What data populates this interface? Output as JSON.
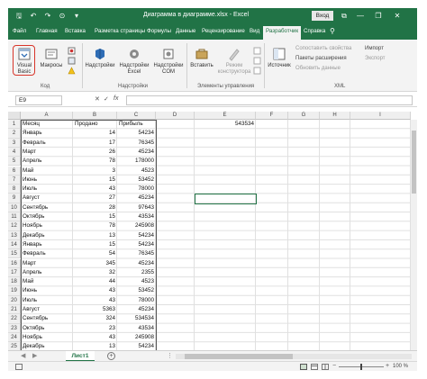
{
  "window": {
    "title": "Диаграмма в диаграмме.xlsx - Excel",
    "login_label": "Вход",
    "controls": [
      "—",
      "❐",
      "✕"
    ],
    "qat_icons": [
      "save-icon",
      "undo-icon",
      "redo-icon",
      "camera-icon",
      "customize-icon"
    ],
    "qat_glyphs": [
      "🖫",
      "↶",
      "↷",
      "⊙",
      "▾"
    ],
    "ribbon_display_glyph": "⧉"
  },
  "ribbon_tabs": [
    {
      "label": "Файл",
      "active": false
    },
    {
      "label": "Главная",
      "active": false
    },
    {
      "label": "Вставка",
      "active": false
    },
    {
      "label": "Разметка страницы",
      "active": false
    },
    {
      "label": "Формулы",
      "active": false
    },
    {
      "label": "Данные",
      "active": false
    },
    {
      "label": "Рецензирование",
      "active": false
    },
    {
      "label": "Вид",
      "active": false
    },
    {
      "label": "Разработчик",
      "active": true
    },
    {
      "label": "Справка",
      "active": false
    }
  ],
  "search_glyph": "⚲",
  "ribbon": {
    "code": {
      "visual_basic": "Visual Basic",
      "macros": "Макросы",
      "label": "Код"
    },
    "addins": {
      "addins": "Надстройки",
      "excel_addins": "Надстройки Excel",
      "com_addins": "Надстройки COM",
      "label": "Надстройки"
    },
    "controls": {
      "insert": "Вставить",
      "design_mode": "Режим конструктора",
      "label": "Элементы управления"
    },
    "xml": {
      "source": "Источник",
      "map_properties": "Сопоставить свойства",
      "expansion_packs": "Пакеты расширения",
      "refresh_data": "Обновить данные",
      "import": "Импорт",
      "export": "Экспорт",
      "label": "XML"
    }
  },
  "formula_bar": {
    "name_box": "E9",
    "fx": "fx",
    "cancel": "✕",
    "enter": "✓",
    "value": ""
  },
  "columns": [
    "A",
    "B",
    "C",
    "D",
    "E",
    "F",
    "G",
    "H",
    "I"
  ],
  "row_numbers": [
    "1",
    "2",
    "3",
    "4",
    "5",
    "6",
    "7",
    "8",
    "9",
    "10",
    "11",
    "12",
    "13",
    "14",
    "15",
    "16",
    "17",
    "18",
    "19",
    "20",
    "21",
    "22",
    "23",
    "24",
    "25"
  ],
  "cells": {
    "header": [
      "Месяц",
      "Продано",
      "Прибыль"
    ],
    "e1": "543534",
    "rows": [
      [
        "Январь",
        "14",
        "54234"
      ],
      [
        "Февраль",
        "17",
        "76345"
      ],
      [
        "Март",
        "26",
        "45234"
      ],
      [
        "Апрель",
        "78",
        "178000"
      ],
      [
        "Май",
        "3",
        "4523"
      ],
      [
        "Июнь",
        "15",
        "53452"
      ],
      [
        "Июль",
        "43",
        "78000"
      ],
      [
        "Август",
        "27",
        "45234"
      ],
      [
        "Сентябрь",
        "28",
        "97643"
      ],
      [
        "Октябрь",
        "15",
        "43534"
      ],
      [
        "Ноябрь",
        "78",
        "245908"
      ],
      [
        "Декабрь",
        "13",
        "54234"
      ],
      [
        "Январь",
        "15",
        "54234"
      ],
      [
        "Февраль",
        "54",
        "76345"
      ],
      [
        "Март",
        "345",
        "45234"
      ],
      [
        "Апрель",
        "32",
        "2355"
      ],
      [
        "Май",
        "44",
        "4523"
      ],
      [
        "Июнь",
        "43",
        "53452"
      ],
      [
        "Июль",
        "43",
        "78000"
      ],
      [
        "Август",
        "5363",
        "45234"
      ],
      [
        "Сентябрь",
        "324",
        "534534"
      ],
      [
        "Октябрь",
        "23",
        "43534"
      ],
      [
        "Ноябрь",
        "43",
        "245908"
      ],
      [
        "Декабрь",
        "13",
        "54234"
      ]
    ]
  },
  "sheets": {
    "active": "Лист1",
    "add": "+",
    "nav_prev": "◀",
    "nav_next": "▶",
    "more": "⋮"
  },
  "status": {
    "zoom": "100 %",
    "zoom_minus": "−",
    "zoom_plus": "+"
  },
  "colors": {
    "accent": "#217346",
    "highlight": "#d8352a"
  }
}
